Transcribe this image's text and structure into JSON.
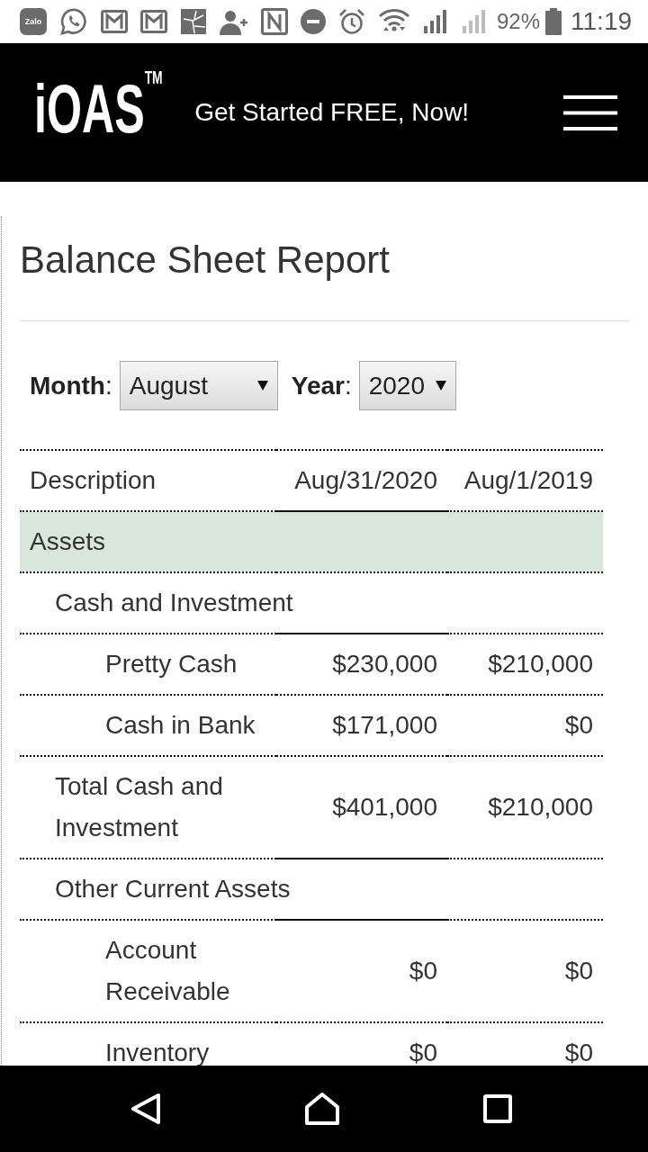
{
  "status_bar": {
    "app_label": "Zalo",
    "battery": "92%",
    "time": "11:19"
  },
  "header": {
    "logo": "iOAS$^{TM}$",
    "tagline": "Get Started FREE, Now!"
  },
  "report": {
    "title": "Balance Sheet Report",
    "filters": [
      {
        "label": "**Month**:",
        "value": "August"
      },
      {
        "label": "**Year**:",
        "value": "2020"
      }
    ]
  },
  "table": {
    "columns": [
      "Description",
      "Aug/31/2020",
      "Aug/1/2019"
    ],
    "rows": [
      {
        "kind": "section",
        "label": "Assets"
      },
      {
        "kind": "group",
        "label": "Cash and Investment"
      },
      {
        "kind": "item",
        "label": "Pretty Cash",
        "values": [
          "$230,000",
          "$210,000"
        ]
      },
      {
        "kind": "item",
        "label": "Cash in Bank",
        "values": [
          "$171,000",
          "$0"
        ]
      },
      {
        "kind": "total",
        "label": "Total Cash and Investment",
        "values": [
          "$401,000",
          "$210,000"
        ]
      },
      {
        "kind": "group",
        "label": "Other Current Assets"
      },
      {
        "kind": "item",
        "label": "Account Receivable",
        "values": [
          "$0",
          "$0"
        ]
      },
      {
        "kind": "item",
        "label": "Inventory",
        "values": [
          "$0",
          "$0"
        ]
      }
    ]
  }
}
